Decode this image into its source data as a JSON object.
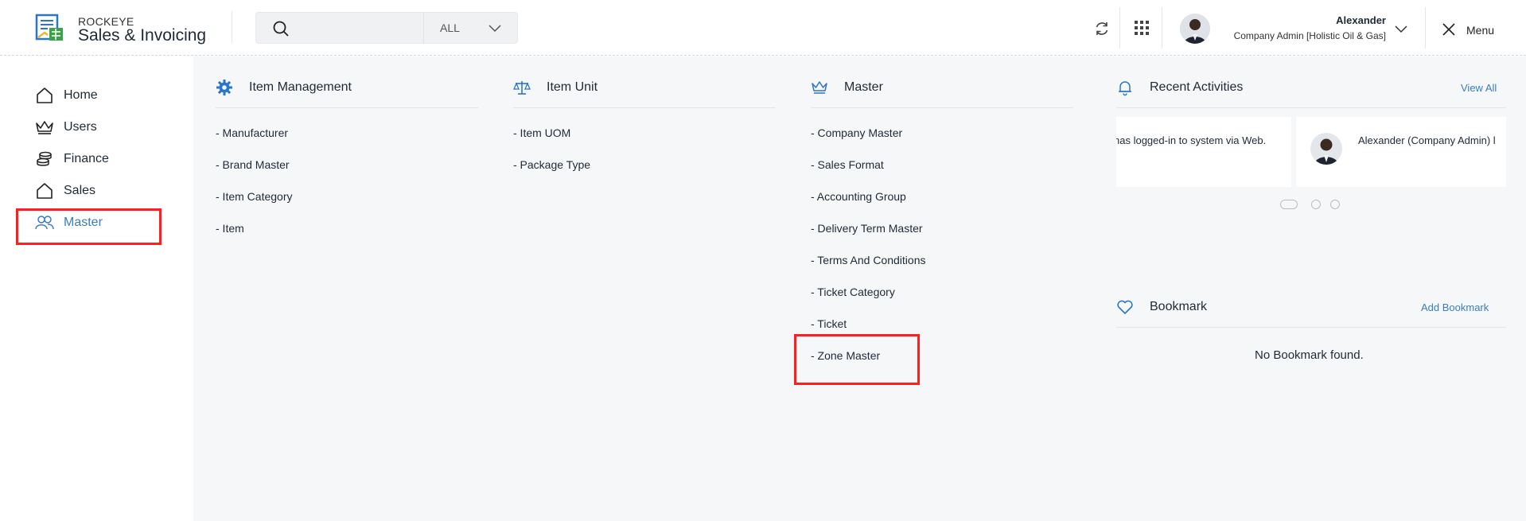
{
  "header": {
    "brand_small": "ROCKEYE",
    "brand_big": "Sales & Invoicing",
    "search": {
      "value": "",
      "placeholder": "",
      "filter_label": "ALL"
    },
    "user": {
      "name": "Alexander",
      "role": "Company Admin [Holistic Oil & Gas]"
    },
    "menu_label": "Menu"
  },
  "sidebar": {
    "items": [
      {
        "label": "Home",
        "icon": "home-icon"
      },
      {
        "label": "Users",
        "icon": "crown-icon"
      },
      {
        "label": "Finance",
        "icon": "coins-icon"
      },
      {
        "label": "Sales",
        "icon": "house-icon"
      },
      {
        "label": "Master",
        "icon": "users-icon",
        "active": true
      }
    ]
  },
  "columns": [
    {
      "title": "Item Management",
      "icon": "gear-icon",
      "links": [
        "- Manufacturer",
        "- Brand Master",
        "- Item Category",
        "- Item"
      ]
    },
    {
      "title": "Item Unit",
      "icon": "scale-icon",
      "links": [
        "- Item UOM",
        "- Package Type"
      ]
    },
    {
      "title": "Master",
      "icon": "crown-icon",
      "links": [
        "- Company Master",
        "- Sales Format",
        "- Accounting Group",
        "- Delivery Term Master",
        "- Terms And Conditions",
        "- Ticket Category",
        "- Ticket",
        "- Zone Master"
      ]
    }
  ],
  "recent": {
    "title": "Recent Activities",
    "view_all": "View All",
    "card1_text": "has logged-in to system via Web.",
    "card2_text": "Alexander (Company Admin) l"
  },
  "bookmark": {
    "title": "Bookmark",
    "add": "Add Bookmark",
    "empty": "No Bookmark found."
  },
  "colors": {
    "accent": "#3a7dc0",
    "highlight": "#ff1f1f",
    "panel_bg": "#f6f7f9"
  }
}
